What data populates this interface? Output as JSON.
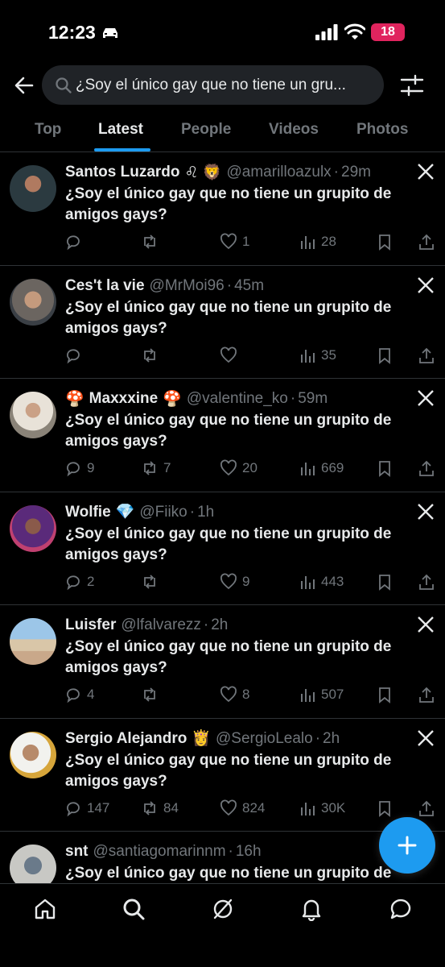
{
  "status_bar": {
    "time": "12:23",
    "battery": "18"
  },
  "search": {
    "query": "¿Soy el único gay que no tiene un gru..."
  },
  "tabs": [
    {
      "label": "Top"
    },
    {
      "label": "Latest"
    },
    {
      "label": "People"
    },
    {
      "label": "Videos"
    },
    {
      "label": "Photos"
    }
  ],
  "active_tab": "Latest",
  "tweets": [
    {
      "name": "Santos Luzardo",
      "emojis": "♌ 🦁",
      "handle": "@amarilloazulx",
      "time": "29m",
      "text": "¿Soy el único gay que no tiene un grupito de amigos gays?",
      "replies": "",
      "reposts": "",
      "likes": "1",
      "views": "28"
    },
    {
      "name": "Ces't la vie",
      "emojis": "",
      "handle": "@MrMoi96",
      "time": "45m",
      "text": "¿Soy el único gay que no tiene un grupito de amigos gays?",
      "replies": "",
      "reposts": "",
      "likes": "",
      "views": "35"
    },
    {
      "name": "Maxxxine",
      "lead_emoji": "🍄",
      "emojis": "🍄",
      "handle": "@valentine_ko",
      "time": "59m",
      "text": "¿Soy el único gay que no tiene un grupito de amigos gays?",
      "replies": "9",
      "reposts": "7",
      "likes": "20",
      "views": "669"
    },
    {
      "name": "Wolfie",
      "emojis": "💎",
      "handle": "@Fiiko",
      "time": "1h",
      "text": "¿Soy el único gay que no tiene un grupito de amigos gays?",
      "replies": "2",
      "reposts": "",
      "likes": "9",
      "views": "443"
    },
    {
      "name": "Luisfer",
      "emojis": "",
      "handle": "@lfalvarezz",
      "time": "2h",
      "text": "¿Soy el único gay que no tiene un grupito de amigos gays?",
      "replies": "4",
      "reposts": "",
      "likes": "8",
      "views": "507"
    },
    {
      "name": "Sergio Alejandro",
      "emojis": "👸",
      "handle": "@SergioLealo",
      "time": "2h",
      "text": "¿Soy el único gay que no tiene un grupito de amigos gays?",
      "replies": "147",
      "reposts": "84",
      "likes": "824",
      "views": "30K"
    },
    {
      "name": "snt",
      "emojis": "",
      "handle": "@santiagomarinnm",
      "time": "16h",
      "text": "¿Soy el único gay que no tiene un grupito de amigos gays?",
      "replies": "",
      "reposts": "",
      "likes": "",
      "views": ""
    }
  ],
  "icons": {
    "back": "arrow-left-icon",
    "search": "search-icon",
    "filter": "sliders-icon",
    "reply": "reply-icon",
    "repost": "repost-icon",
    "like": "heart-icon",
    "views": "views-icon",
    "bookmark": "bookmark-icon",
    "share": "share-icon",
    "fab": "plus-icon",
    "nav": [
      "home-icon",
      "search-icon",
      "grok-icon",
      "bell-icon",
      "messages-icon"
    ]
  },
  "colors": {
    "accent": "#1d9bf0",
    "background": "#000000",
    "muted": "#71767b",
    "battery": "#e0245e"
  }
}
